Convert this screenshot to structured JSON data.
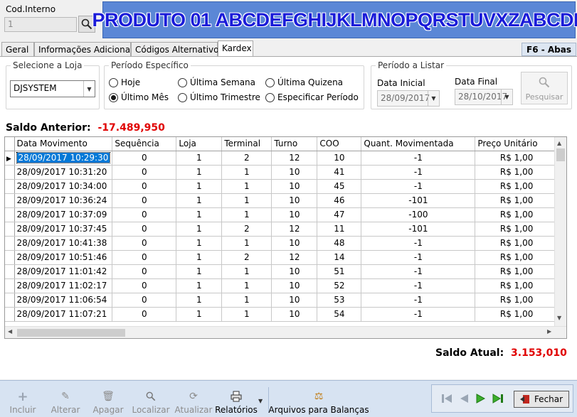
{
  "header": {
    "cod_label": "Cod.Interno",
    "cod_value": "1",
    "title": "PRODUTO 01 ABCDEFGHIJKLMNOPQRSTUVXZABCDE"
  },
  "tabs": [
    {
      "label": "Geral"
    },
    {
      "label": "Informações Adicionais"
    },
    {
      "label": "Códigos Alternativos"
    },
    {
      "label": "Kardex"
    }
  ],
  "f6_label": "F6 - Abas",
  "loja": {
    "legend": "Selecione a Loja",
    "value": "DJSYSTEM"
  },
  "periodo": {
    "legend": "Período Específico",
    "options": [
      {
        "label": "Hoje",
        "checked": false
      },
      {
        "label": "Última Semana",
        "checked": false
      },
      {
        "label": "Última Quizena",
        "checked": false
      },
      {
        "label": "Último Mês",
        "checked": true
      },
      {
        "label": "Último Trimestre",
        "checked": false
      },
      {
        "label": "Especificar Período",
        "checked": false
      }
    ]
  },
  "listar": {
    "legend": "Período a Listar",
    "inicial_label": "Data  Inicial",
    "inicial_value": "28/09/2017",
    "final_label": "Data Final",
    "final_value": "28/10/2017",
    "pesquisar": "Pesquisar"
  },
  "saldo_anterior": {
    "label": "Saldo Anterior:",
    "value": "-17.489,950"
  },
  "saldo_atual": {
    "label": "Saldo Atual:",
    "value": "3.153,010"
  },
  "grid": {
    "columns": [
      "Data Movimento",
      "Sequência",
      "Loja",
      "Terminal",
      "Turno",
      "COO",
      "Quant. Movimentada",
      "Preço Unitário"
    ],
    "rows": [
      [
        "28/09/2017 10:29:30",
        "0",
        "1",
        "2",
        "12",
        "10",
        "-1",
        "R$ 1,00"
      ],
      [
        "28/09/2017 10:31:20",
        "0",
        "1",
        "1",
        "10",
        "41",
        "-1",
        "R$ 1,00"
      ],
      [
        "28/09/2017 10:34:00",
        "0",
        "1",
        "1",
        "10",
        "45",
        "-1",
        "R$ 1,00"
      ],
      [
        "28/09/2017 10:36:24",
        "0",
        "1",
        "1",
        "10",
        "46",
        "-101",
        "R$ 1,00"
      ],
      [
        "28/09/2017 10:37:09",
        "0",
        "1",
        "1",
        "10",
        "47",
        "-100",
        "R$ 1,00"
      ],
      [
        "28/09/2017 10:37:45",
        "0",
        "1",
        "2",
        "12",
        "11",
        "-101",
        "R$ 1,00"
      ],
      [
        "28/09/2017 10:41:38",
        "0",
        "1",
        "1",
        "10",
        "48",
        "-1",
        "R$ 1,00"
      ],
      [
        "28/09/2017 10:51:46",
        "0",
        "1",
        "2",
        "12",
        "14",
        "-1",
        "R$ 1,00"
      ],
      [
        "28/09/2017 11:01:42",
        "0",
        "1",
        "1",
        "10",
        "51",
        "-1",
        "R$ 1,00"
      ],
      [
        "28/09/2017 11:02:17",
        "0",
        "1",
        "1",
        "10",
        "52",
        "-1",
        "R$ 1,00"
      ],
      [
        "28/09/2017 11:06:54",
        "0",
        "1",
        "1",
        "10",
        "53",
        "-1",
        "R$ 1,00"
      ],
      [
        "28/09/2017 11:07:21",
        "0",
        "1",
        "1",
        "10",
        "54",
        "-1",
        "R$ 1,00"
      ]
    ]
  },
  "toolbar": {
    "incluir": "Incluir",
    "alterar": "Alterar",
    "apagar": "Apagar",
    "localizar": "Localizar",
    "atualizar": "Atualizar",
    "relatorios": "Relatórios",
    "arquivos": "Arquivos para Balanças",
    "fechar": "Fechar"
  }
}
